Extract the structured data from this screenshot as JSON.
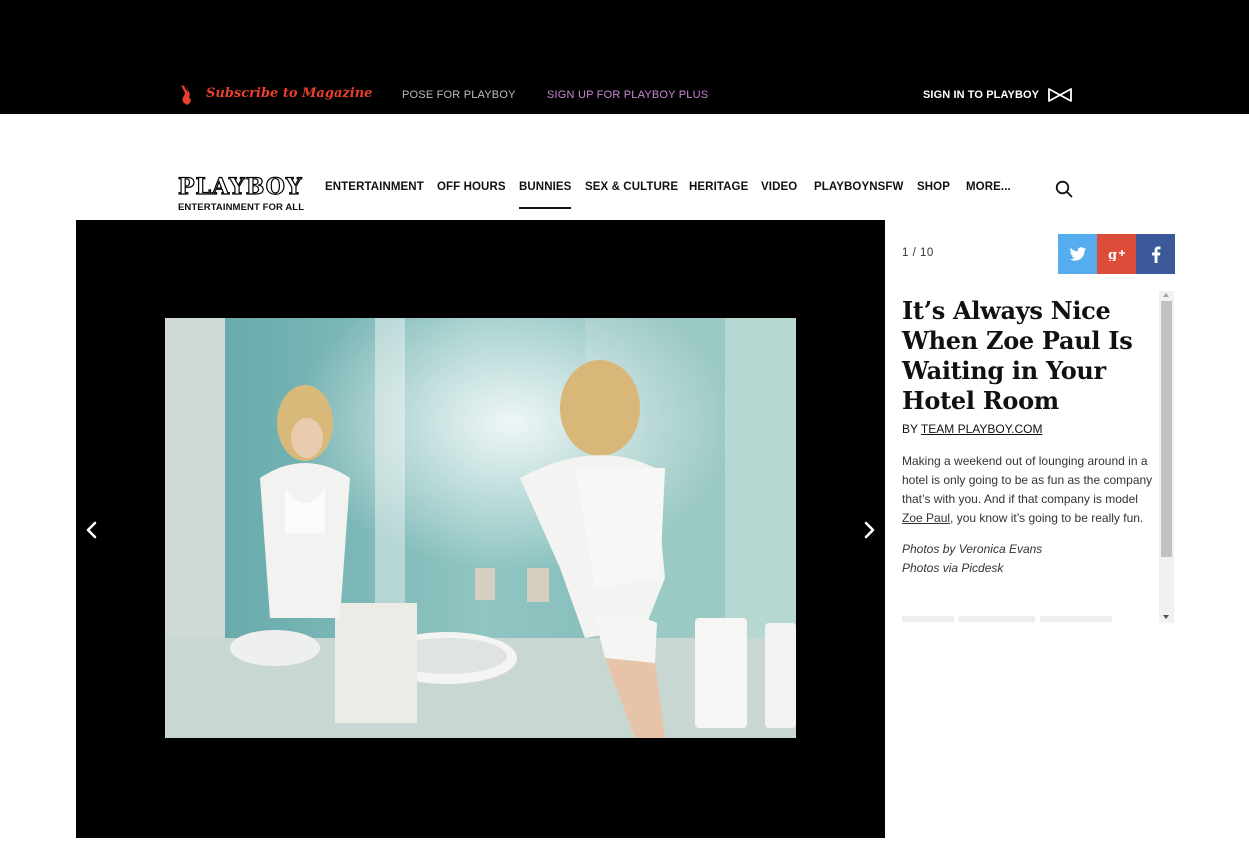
{
  "topbar": {
    "subscribe": "Subscribe to Magazine",
    "pose": "POSE FOR PLAYBOY",
    "plus": "SIGN UP FOR PLAYBOY PLUS",
    "signin": "SIGN IN TO PLAYBOY",
    "colors": {
      "subscribe": "#e8402c",
      "plus": "#c887d6"
    }
  },
  "header": {
    "logo": "PLAYBOY",
    "tagline": "ENTERTAINMENT FOR ALL",
    "nav": [
      {
        "label": "ENTERTAINMENT"
      },
      {
        "label": "OFF HOURS"
      },
      {
        "label": "BUNNIES",
        "active": true
      },
      {
        "label": "SEX & CULTURE"
      },
      {
        "label": "HERITAGE"
      },
      {
        "label": "VIDEO"
      },
      {
        "label": "PLAYBOYNSFW"
      },
      {
        "label": "SHOP"
      },
      {
        "label": "MORE..."
      }
    ]
  },
  "gallery": {
    "counter": "1 / 10",
    "prev_icon": "chevron-left-icon",
    "next_icon": "chevron-right-icon"
  },
  "share": {
    "twitter_icon": "twitter-icon",
    "google_icon": "google-plus-icon",
    "facebook_icon": "facebook-icon",
    "colors": {
      "twitter": "#55acee",
      "google": "#dd4b39",
      "facebook": "#3b5998"
    }
  },
  "article": {
    "title": "It’s Always Nice When Zoe Paul Is Waiting in Your Hotel Room",
    "by_prefix": "BY",
    "author": "TEAM PLAYBOY.COM",
    "desc_before": "Making a weekend out of lounging around in a hotel is only going to be as fun as the company that’s with you. And if that company is model",
    "desc_link": "Zoe Paul",
    "desc_after": ", you know it’s going to be really fun.",
    "credit_photos": "Photos by Veronica Evans",
    "credit_via": "Photos via Picdesk"
  }
}
